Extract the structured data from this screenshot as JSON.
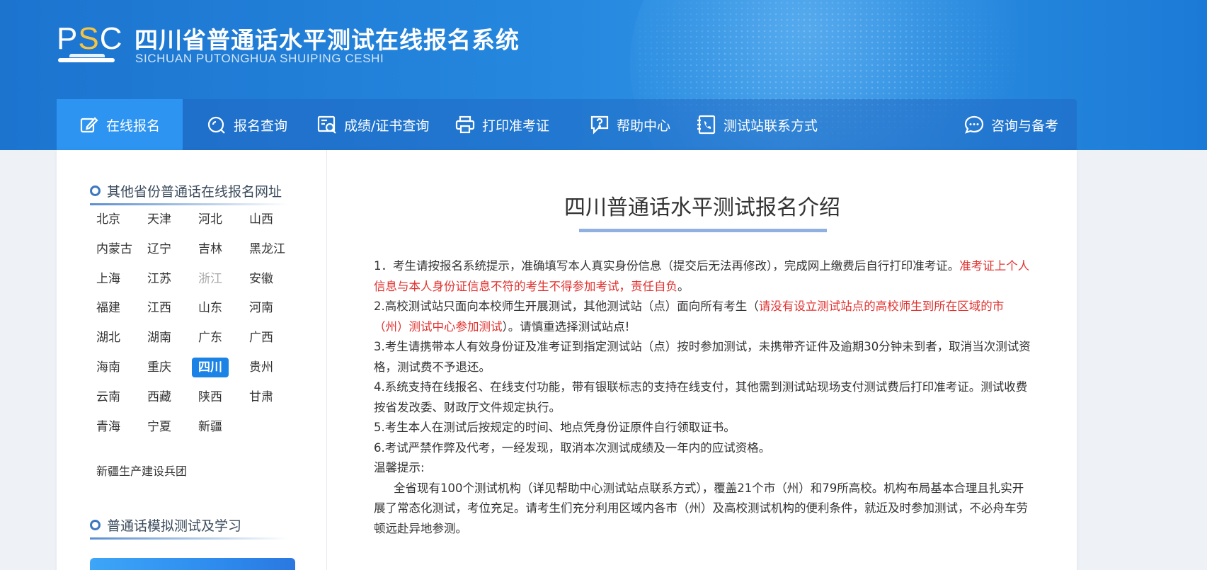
{
  "header": {
    "logo_letters": {
      "p": "P",
      "s": "S",
      "c": "C"
    },
    "title": "四川省普通话水平测试在线报名系统",
    "subtitle": "SICHUAN PUTONGHUA SHUIPING CESHI"
  },
  "nav": {
    "items": [
      {
        "label": "在线报名",
        "icon": "edit-icon",
        "active": true
      },
      {
        "label": "报名查询",
        "icon": "search-icon"
      },
      {
        "label": "成绩/证书查询",
        "icon": "certificate-search-icon"
      },
      {
        "label": "打印准考证",
        "icon": "printer-icon"
      },
      {
        "label": "帮助中心",
        "icon": "help-icon"
      },
      {
        "label": "测试站联系方式",
        "icon": "phone-book-icon"
      },
      {
        "label": "咨询与备考",
        "icon": "chat-icon"
      }
    ]
  },
  "sidebar": {
    "section1_title": "其他省份普通话在线报名网址",
    "provinces": [
      "北京",
      "天津",
      "河北",
      "山西",
      "内蒙古",
      "辽宁",
      "吉林",
      "黑龙江",
      "上海",
      "江苏",
      "浙江",
      "安徽",
      "福建",
      "江西",
      "山东",
      "河南",
      "湖北",
      "湖南",
      "广东",
      "广西",
      "海南",
      "重庆",
      "四川",
      "贵州",
      "云南",
      "西藏",
      "陕西",
      "甘肃",
      "青海",
      "宁夏",
      "新疆"
    ],
    "active_province": "四川",
    "disabled_province": "浙江",
    "extra": "新疆生产建设兵团",
    "section2_title": "普通话模拟测试及学习"
  },
  "content": {
    "title": "四川普通话水平测试报名介绍",
    "p1_a": "1．考生请按报名系统提示，准确填写本人真实身份信息（提交后无法再修改），完成网上缴费后自行打印准考证。",
    "p1_red": "准考证上个人信息与本人身份证信息不符的考生不得参加考试，责任自负",
    "p1_end": "。",
    "p2_a": "2.高校测试站只面向本校师生开展测试，其他测试站（点）面向所有考生（",
    "p2_red": "请没有设立测试站点的高校师生到所在区域的市（州）测试中心参加测试",
    "p2_end": "）。请慎重选择测试站点!",
    "p3": "3.考生请携带本人有效身份证及准考证到指定测试站（点）按时参加测试，未携带齐证件及逾期30分钟未到者，取消当次测试资格，测试费不予退还。",
    "p4": "4.系统支持在线报名、在线支付功能，带有银联标志的支持在线支付，其他需到测试站现场支付测试费后打印准考证。测试收费按省发改委、财政厅文件规定执行。",
    "p5": "5.考生本人在测试后按规定的时间、地点凭身份证原件自行领取证书。",
    "p6": "6.考试严禁作弊及代考，一经发现，取消本次测试成绩及一年内的应试资格。",
    "tip_label": "温馨提示:",
    "tip_body": "全省现有100个测试机构（详见帮助中心测试站点联系方式），覆盖21个市（州）和79所高校。机构布局基本合理且扎实开展了常态化测试，考位充足。请考生们充分利用区域内各市（州）及高校测试机构的便利条件，就近及时参加测试，不必舟车劳顿远赴异地参测。"
  },
  "colors": {
    "header_blue": "#2587de",
    "nav_active": "#2d94f2",
    "accent_red": "#e0322f",
    "province_active": "#1b82e6"
  }
}
